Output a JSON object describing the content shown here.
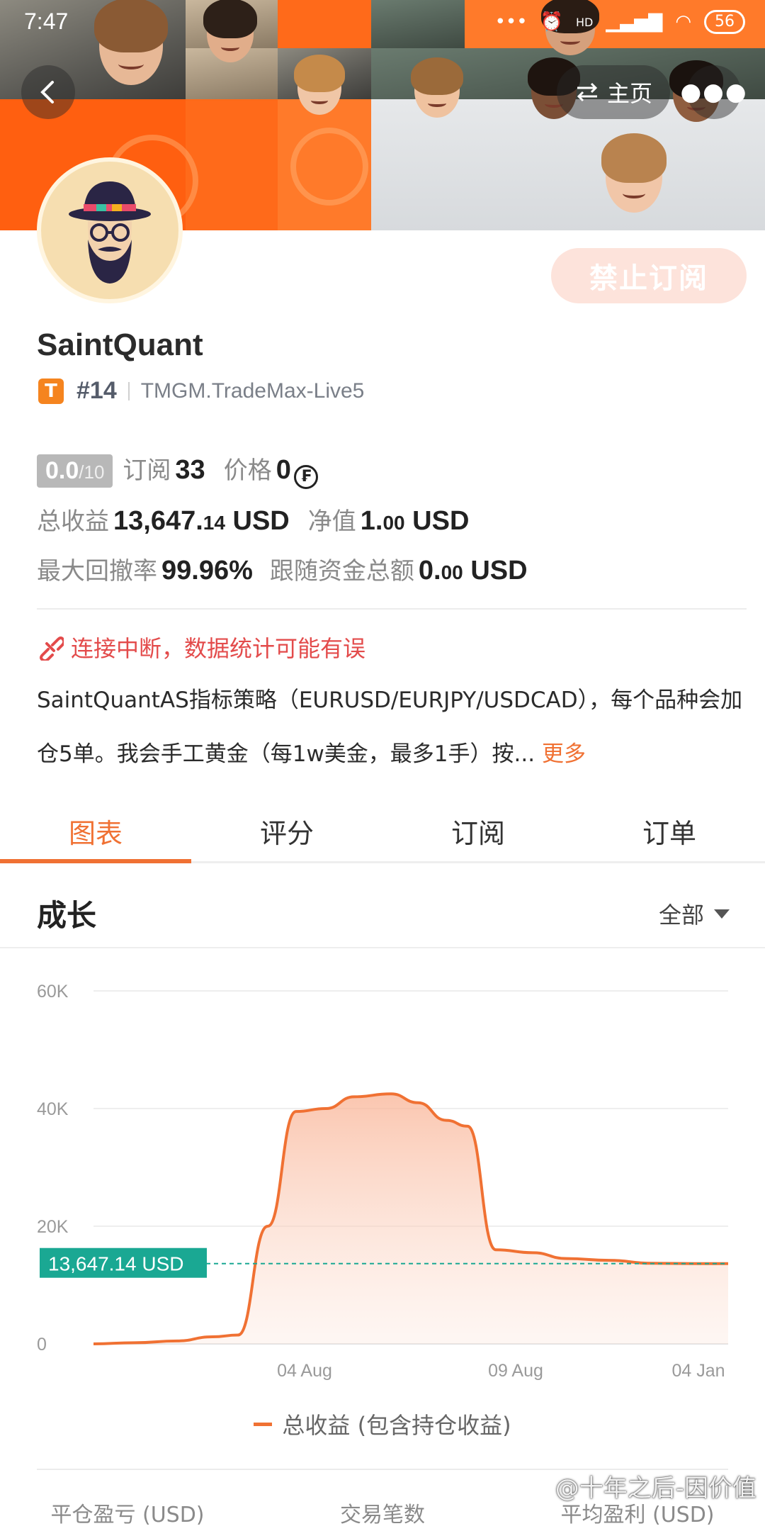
{
  "status_bar": {
    "time": "7:47",
    "hd": "HD",
    "battery": "56"
  },
  "nav": {
    "home_label": "主页"
  },
  "colors": {
    "accent": "#f07133",
    "badge": "#f5841f",
    "chart_line": "#f07133",
    "current_value_tag": "#1aa893",
    "warning": "#e34b4b"
  },
  "icons": {
    "back": "chevron-left-icon",
    "switch": "swap-arrows-icon",
    "more": "ellipsis-icon",
    "avatar": "hat-glasses-beard-avatar",
    "link_broken": "link-broken-icon",
    "currency": "coin-icon",
    "dropdown": "caret-down-icon"
  },
  "profile": {
    "subscribe_button": "禁止订阅",
    "name": "SaintQuant",
    "tier_badge": "T",
    "rank": "#14",
    "server": "TMGM.TradeMax-Live5"
  },
  "stats": {
    "score": "0.0",
    "score_max": "/10",
    "subs_label": "订阅",
    "subs_value": "33",
    "price_label": "价格",
    "price_value": "0",
    "total_profit_label": "总收益",
    "total_profit_int": "13,647.",
    "total_profit_dec": "14",
    "total_profit_unit": "USD",
    "net_value_label": "净值",
    "net_value_int": "1.",
    "net_value_dec": "00",
    "net_value_unit": "USD",
    "max_drawdown_label": "最大回撤率",
    "max_drawdown_value": "99.96%",
    "follow_funds_label": "跟随资金总额",
    "follow_funds_int": "0.",
    "follow_funds_dec": "00",
    "follow_funds_unit": "USD"
  },
  "warning": "连接中断，数据统计可能有误",
  "description": {
    "text": "SaintQuantAS指标策略（EURUSD/EURJPY/USDCAD），每个品种会加仓5单。我会手工黄金（每1w美金，最多1手）按...",
    "more": "更多"
  },
  "tabs": [
    {
      "label": "图表",
      "active": true
    },
    {
      "label": "评分",
      "active": false
    },
    {
      "label": "订阅",
      "active": false
    },
    {
      "label": "订单",
      "active": false
    }
  ],
  "growth": {
    "title": "成长",
    "range": "全部"
  },
  "chart_data": {
    "type": "area",
    "title": "",
    "xlabel": "",
    "ylabel": "",
    "ylim": [
      0,
      60000
    ],
    "y_ticks": [
      "0",
      "20K",
      "40K",
      "60K"
    ],
    "x_tick_labels": [
      "04 Aug",
      "09 Aug",
      "04 Jan"
    ],
    "grid": true,
    "legend_position": "bottom",
    "current_value_label": "13,647.14 USD",
    "current_value": 13647.14,
    "series": [
      {
        "name": "总收益 (包含持仓收益)",
        "values": [
          0,
          200,
          500,
          1200,
          1500,
          20000,
          39500,
          40000,
          42000,
          42500,
          41000,
          38000,
          37000,
          16000,
          15500,
          14500,
          14200,
          13700,
          13647,
          13647
        ]
      }
    ]
  },
  "footer": {
    "col1": "平仓盈亏 (USD)",
    "col2": "交易笔数",
    "col3": "平均盈利 (USD)"
  },
  "watermark": "@十年之后-因价值"
}
